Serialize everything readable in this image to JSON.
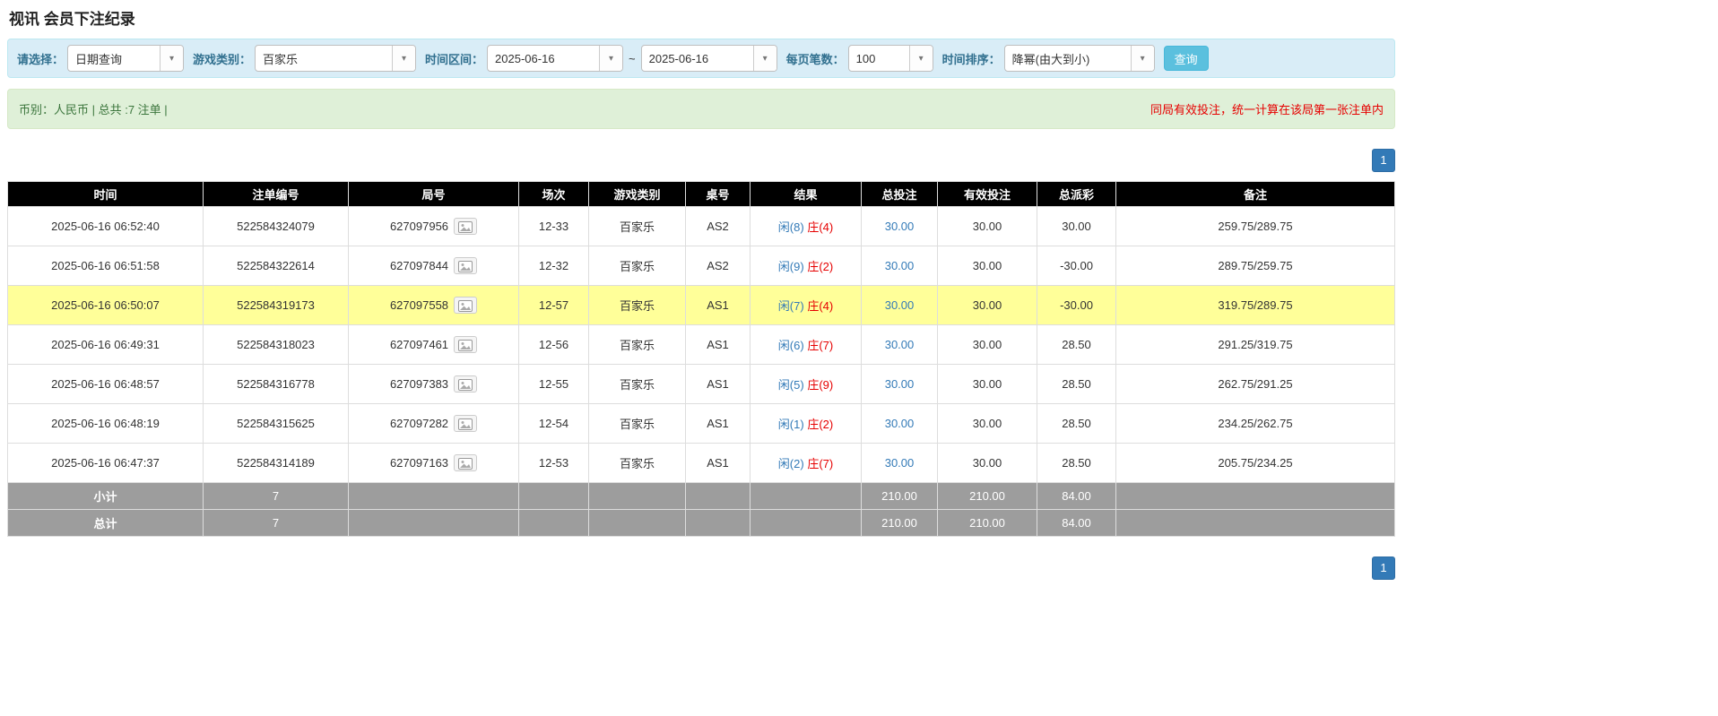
{
  "page": {
    "title": "视讯 会员下注纪录"
  },
  "colors": {
    "accent_blue": "#337ab7",
    "alert_red": "#e60000",
    "highlight_row": "#ffff99",
    "header_bg": "#000000",
    "footer_bg": "#9d9d9d",
    "filter_bar_bg": "#d9edf7",
    "summary_bar_bg": "#dff0d8",
    "search_button_bg": "#5bc0de"
  },
  "filters": {
    "select": {
      "label": "请选择：",
      "value": "日期查询"
    },
    "game": {
      "label": "游戏类别：",
      "value": "百家乐"
    },
    "range": {
      "label": "时间区间：",
      "from": "2025-06-16",
      "separator": "~",
      "to": "2025-06-16"
    },
    "page_size": {
      "label": "每页笔数：",
      "value": "100"
    },
    "sort": {
      "label": "时间排序：",
      "value": "降幂(由大到小)"
    },
    "search_label": "查询"
  },
  "summary": {
    "left": "币别：人民币 | 总共 :7 注单 |",
    "right": "同局有效投注，统一计算在该局第一张注单内"
  },
  "pagination": {
    "current": "1"
  },
  "table": {
    "headers": [
      "时间",
      "注单编号",
      "局号",
      "场次",
      "游戏类别",
      "桌号",
      "结果",
      "总投注",
      "有效投注",
      "总派彩",
      "备注"
    ],
    "rows": [
      {
        "time": "2025-06-16 06:52:40",
        "bet_id": "522584324079",
        "round": "627097956",
        "session": "12-33",
        "game": "百家乐",
        "table_no": "AS2",
        "result_player": "闲(8)",
        "result_banker": "庄(4)",
        "total_bet": "30.00",
        "valid_bet": "30.00",
        "payout": "30.00",
        "note": "259.75/289.75",
        "highlight": false
      },
      {
        "time": "2025-06-16 06:51:58",
        "bet_id": "522584322614",
        "round": "627097844",
        "session": "12-32",
        "game": "百家乐",
        "table_no": "AS2",
        "result_player": "闲(9)",
        "result_banker": "庄(2)",
        "total_bet": "30.00",
        "valid_bet": "30.00",
        "payout": "-30.00",
        "note": "289.75/259.75",
        "highlight": false
      },
      {
        "time": "2025-06-16 06:50:07",
        "bet_id": "522584319173",
        "round": "627097558",
        "session": "12-57",
        "game": "百家乐",
        "table_no": "AS1",
        "result_player": "闲(7)",
        "result_banker": "庄(4)",
        "total_bet": "30.00",
        "valid_bet": "30.00",
        "payout": "-30.00",
        "note": "319.75/289.75",
        "highlight": true
      },
      {
        "time": "2025-06-16 06:49:31",
        "bet_id": "522584318023",
        "round": "627097461",
        "session": "12-56",
        "game": "百家乐",
        "table_no": "AS1",
        "result_player": "闲(6)",
        "result_banker": "庄(7)",
        "total_bet": "30.00",
        "valid_bet": "30.00",
        "payout": "28.50",
        "note": "291.25/319.75",
        "highlight": false
      },
      {
        "time": "2025-06-16 06:48:57",
        "bet_id": "522584316778",
        "round": "627097383",
        "session": "12-55",
        "game": "百家乐",
        "table_no": "AS1",
        "result_player": "闲(5)",
        "result_banker": "庄(9)",
        "total_bet": "30.00",
        "valid_bet": "30.00",
        "payout": "28.50",
        "note": "262.75/291.25",
        "highlight": false
      },
      {
        "time": "2025-06-16 06:48:19",
        "bet_id": "522584315625",
        "round": "627097282",
        "session": "12-54",
        "game": "百家乐",
        "table_no": "AS1",
        "result_player": "闲(1)",
        "result_banker": "庄(2)",
        "total_bet": "30.00",
        "valid_bet": "30.00",
        "payout": "28.50",
        "note": "234.25/262.75",
        "highlight": false
      },
      {
        "time": "2025-06-16 06:47:37",
        "bet_id": "522584314189",
        "round": "627097163",
        "session": "12-53",
        "game": "百家乐",
        "table_no": "AS1",
        "result_player": "闲(2)",
        "result_banker": "庄(7)",
        "total_bet": "30.00",
        "valid_bet": "30.00",
        "payout": "28.50",
        "note": "205.75/234.25",
        "highlight": false
      }
    ],
    "subtotal": {
      "label": "小计",
      "count": "7",
      "total_bet": "210.00",
      "valid_bet": "210.00",
      "payout": "84.00"
    },
    "total": {
      "label": "总计",
      "count": "7",
      "total_bet": "210.00",
      "valid_bet": "210.00",
      "payout": "84.00"
    }
  }
}
